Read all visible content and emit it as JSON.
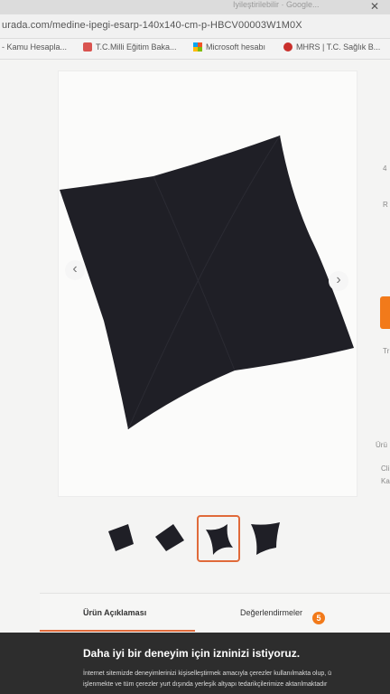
{
  "browser": {
    "tab_chip": "Iyileştirilebilir · Google...",
    "url": "urada.com/medine-ipegi-esarp-140x140-cm-p-HBCV00003W1M0X",
    "bookmarks": [
      {
        "label": "- Kamu Hesapla...",
        "icon": "globe-icon"
      },
      {
        "label": "T.C.Milli Eğitim Baka...",
        "icon": "tc-icon"
      },
      {
        "label": "Microsoft hesabı",
        "icon": "microsoft-icon"
      },
      {
        "label": "MHRS | T.C. Sağlık B...",
        "icon": "mhrs-icon"
      }
    ]
  },
  "gallery": {
    "prev_label": "‹",
    "next_label": "›",
    "thumbnail_count": 4,
    "selected_thumbnail": 3
  },
  "right_edge": {
    "t1": "4",
    "t2": "R",
    "t3": "Tr",
    "t4": "Ürü",
    "t5": "Cli",
    "t6": "Ka"
  },
  "tabs": {
    "description": "Ürün Açıklaması",
    "reviews": "Değerlendirmeler",
    "reviews_count": "5"
  },
  "cookie": {
    "title": "Daha iyi bir deneyim için izninizi istiyoruz.",
    "line1": "İnternet sitemizde deneyimlerinizi kişiselleştirmek amacıyla çerezler kullanılmakta olup, ü",
    "line2": "işlenmekte ve tüm çerezler yurt dışında yerleşik altyapı tedarikçilerimize aktarılmaktadır"
  },
  "colors": {
    "accent": "#f27a1a",
    "scarf": "#1f1f26",
    "cookie_bg": "#2d2d2d"
  }
}
